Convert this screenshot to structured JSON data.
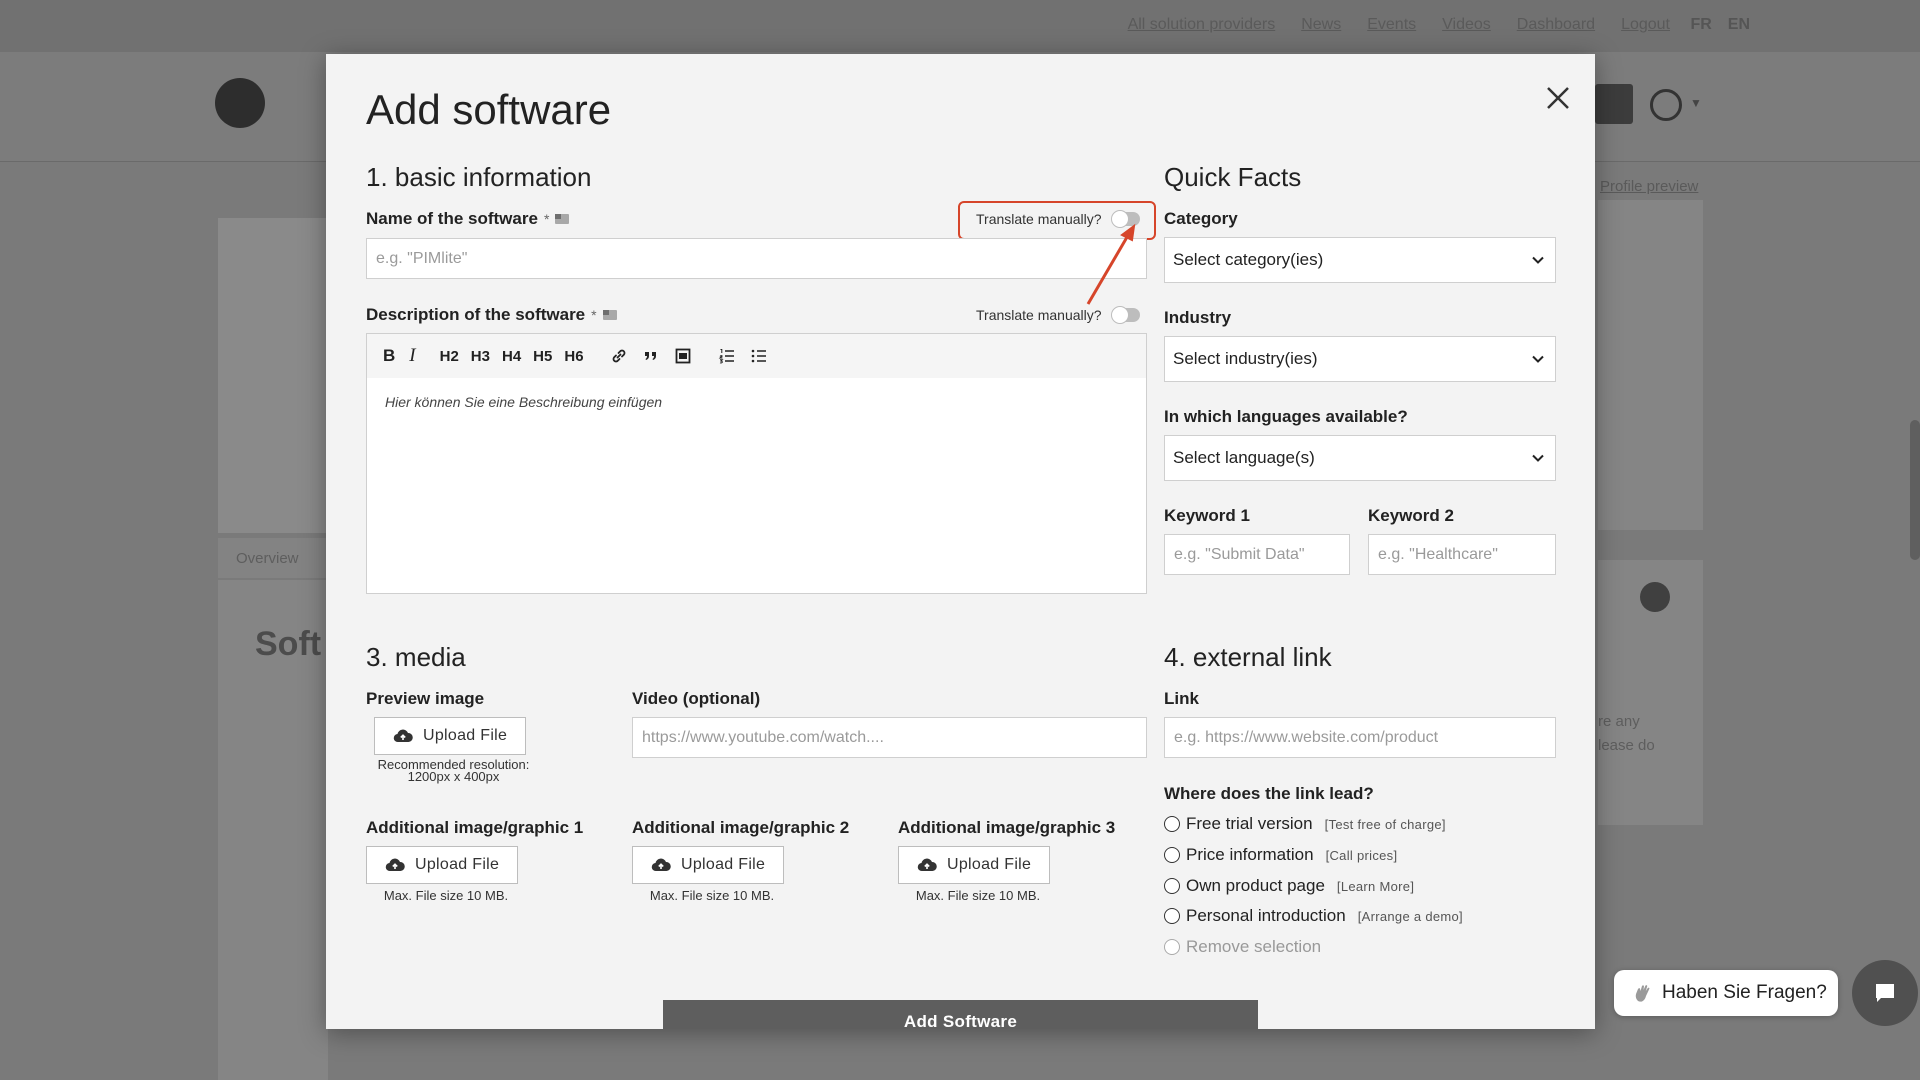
{
  "background": {
    "top_links": [
      "All solution providers",
      "News",
      "Events",
      "Videos",
      "Dashboard",
      "Logout"
    ],
    "languages": [
      "FR",
      "EN"
    ],
    "profile_preview": "Profile preview",
    "overview_tab": "Overview",
    "heading_fragment": "Soft",
    "side_text": [
      "re any",
      "lease do"
    ]
  },
  "modal": {
    "title": "Add software",
    "close_icon": "close-icon"
  },
  "basic": {
    "section_title": "1. basic information",
    "name_label": "Name of the software",
    "required_mark": "*",
    "name_placeholder": "e.g. \"PIMlite\"",
    "translate_label": "Translate manually?",
    "description_label": "Description of the software",
    "description_placeholder": "Hier können Sie eine Beschreibung einfügen",
    "toolbar": {
      "bold": "B",
      "italic": "I",
      "headings": [
        "H2",
        "H3",
        "H4",
        "H5",
        "H6"
      ],
      "icons": [
        "link-icon",
        "quote-icon",
        "image-icon",
        "ordered-list-icon",
        "bullet-list-icon"
      ]
    }
  },
  "quick_facts": {
    "section_title": "Quick Facts",
    "category_label": "Category",
    "category_value": "Select category(ies)",
    "industry_label": "Industry",
    "industry_value": "Select industry(ies)",
    "languages_label": "In which languages available?",
    "languages_value": "Select language(s)",
    "keyword1_label": "Keyword 1",
    "keyword1_placeholder": "e.g. \"Submit Data\"",
    "keyword2_label": "Keyword 2",
    "keyword2_placeholder": "e.g. \"Healthcare\""
  },
  "media": {
    "section_title": "3. media",
    "preview_label": "Preview image",
    "upload_label": "Upload File",
    "recommended_line1": "Recommended resolution:",
    "recommended_line2": "1200px x 400px",
    "video_label": "Video (optional)",
    "video_placeholder": "https://www.youtube.com/watch....",
    "additional": [
      {
        "label": "Additional image/graphic 1",
        "note": "Max. File size 10 MB."
      },
      {
        "label": "Additional image/graphic 2",
        "note": "Max. File size 10 MB."
      },
      {
        "label": "Additional image/graphic 3",
        "note": "Max. File size 10 MB."
      }
    ]
  },
  "external": {
    "section_title": "4. external link",
    "link_label": "Link",
    "link_placeholder": "e.g. https://www.website.com/product",
    "lead_label": "Where does the link lead?",
    "options": [
      {
        "label": "Free trial version",
        "hint": "[Test free of charge]"
      },
      {
        "label": "Price information",
        "hint": "[Call prices]"
      },
      {
        "label": "Own product page",
        "hint": "[Learn More]"
      },
      {
        "label": "Personal introduction",
        "hint": "[Arrange a demo]"
      }
    ],
    "remove_selection": "Remove selection"
  },
  "submit_label": "Add Software",
  "chat": {
    "bubble_text": "Haben Sie Fragen?"
  },
  "colors": {
    "highlight": "#d6452a",
    "submit_bg": "#5e5e5e",
    "modal_bg": "#f3f3f3"
  }
}
